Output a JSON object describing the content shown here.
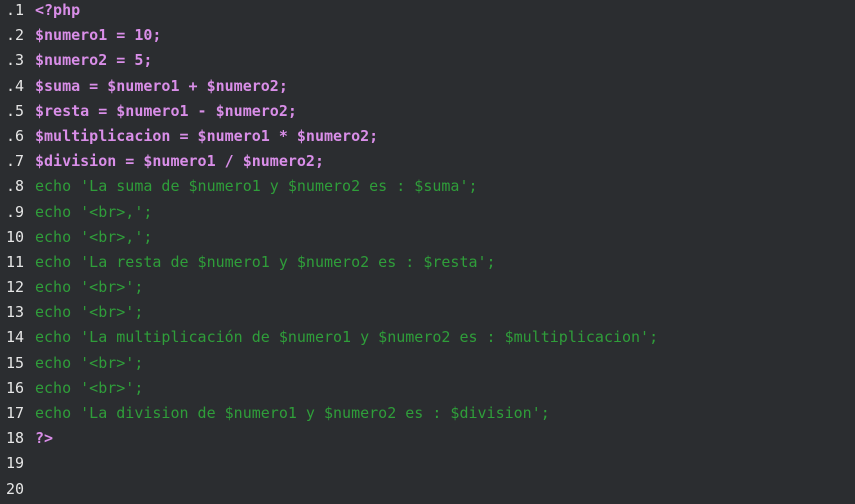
{
  "editor": {
    "lines": [
      {
        "number": ".1",
        "code": "<?php",
        "style": "php"
      },
      {
        "number": ".2",
        "code": "$numero1 = 10;",
        "style": "php"
      },
      {
        "number": ".3",
        "code": "$numero2 = 5;",
        "style": "php"
      },
      {
        "number": ".4",
        "code": "$suma = $numero1 + $numero2;",
        "style": "php"
      },
      {
        "number": ".5",
        "code": "$resta = $numero1 - $numero2;",
        "style": "php"
      },
      {
        "number": ".6",
        "code": "$multiplicacion = $numero1 * $numero2;",
        "style": "php"
      },
      {
        "number": ".7",
        "code": "$division = $numero1 / $numero2;",
        "style": "php"
      },
      {
        "number": ".8",
        "code": "echo 'La suma de $numero1 y $numero2 es : $suma';",
        "style": "echo"
      },
      {
        "number": ".9",
        "code": "echo '<br>,';",
        "style": "echo"
      },
      {
        "number": "10",
        "code": "echo '<br>,';",
        "style": "echo"
      },
      {
        "number": "11",
        "code": "echo 'La resta de $numero1 y $numero2 es : $resta';",
        "style": "echo"
      },
      {
        "number": "12",
        "code": "echo '<br>';",
        "style": "echo"
      },
      {
        "number": "13",
        "code": "echo '<br>';",
        "style": "echo"
      },
      {
        "number": "14",
        "code": "echo 'La multiplicación de $numero1 y $numero2 es : $multiplicacion';",
        "style": "echo"
      },
      {
        "number": "15",
        "code": "echo '<br>';",
        "style": "echo"
      },
      {
        "number": "16",
        "code": "echo '<br>';",
        "style": "echo"
      },
      {
        "number": "17",
        "code": "echo 'La division de $numero1 y $numero2 es : $division';",
        "style": "echo"
      },
      {
        "number": "18",
        "code": "?>",
        "style": "php"
      },
      {
        "number": "19",
        "code": "",
        "style": "php"
      },
      {
        "number": "20",
        "code": "",
        "style": "php"
      }
    ]
  },
  "colors": {
    "background": "#2b2d30",
    "php_token": "#d98ee8",
    "echo_token": "#2f9e3a",
    "line_number": "#e6e6e6"
  }
}
